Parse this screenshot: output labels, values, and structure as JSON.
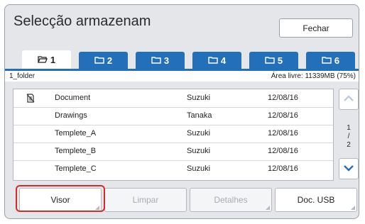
{
  "window": {
    "title": "Selecção armazenam",
    "close_label": "Fechar"
  },
  "tabs": [
    {
      "label": "1",
      "icon": "folder-open-icon",
      "active": true
    },
    {
      "label": "2",
      "icon": "folder-icon",
      "active": false
    },
    {
      "label": "3",
      "icon": "folder-icon",
      "active": false
    },
    {
      "label": "4",
      "icon": "folder-icon",
      "active": false
    },
    {
      "label": "5",
      "icon": "folder-icon",
      "active": false
    },
    {
      "label": "6",
      "icon": "folder-icon",
      "active": false
    }
  ],
  "folder": {
    "name": "1_folder",
    "free_space": "Área livre: 11339MB (75%)"
  },
  "files": [
    {
      "name": "Document",
      "owner": "Suzuki",
      "date": "12/08/16",
      "icon": "document-status-icon"
    },
    {
      "name": "Drawings",
      "owner": "Tanaka",
      "date": "12/08/16"
    },
    {
      "name": "Templete_A",
      "owner": "Suzuki",
      "date": "12/08/16"
    },
    {
      "name": "Templete_B",
      "owner": "Suzuki",
      "date": "12/08/16"
    },
    {
      "name": "Templete_C",
      "owner": "Suzuki",
      "date": "12/08/16"
    }
  ],
  "pager": {
    "current": "1",
    "separator": "/",
    "total": "2"
  },
  "buttons": {
    "viewer": "Visor",
    "clear": "Limpar",
    "details": "Detalhes",
    "usb": "Doc. USB"
  },
  "colors": {
    "accent": "#236fb9",
    "highlight": "#d62b2b"
  }
}
